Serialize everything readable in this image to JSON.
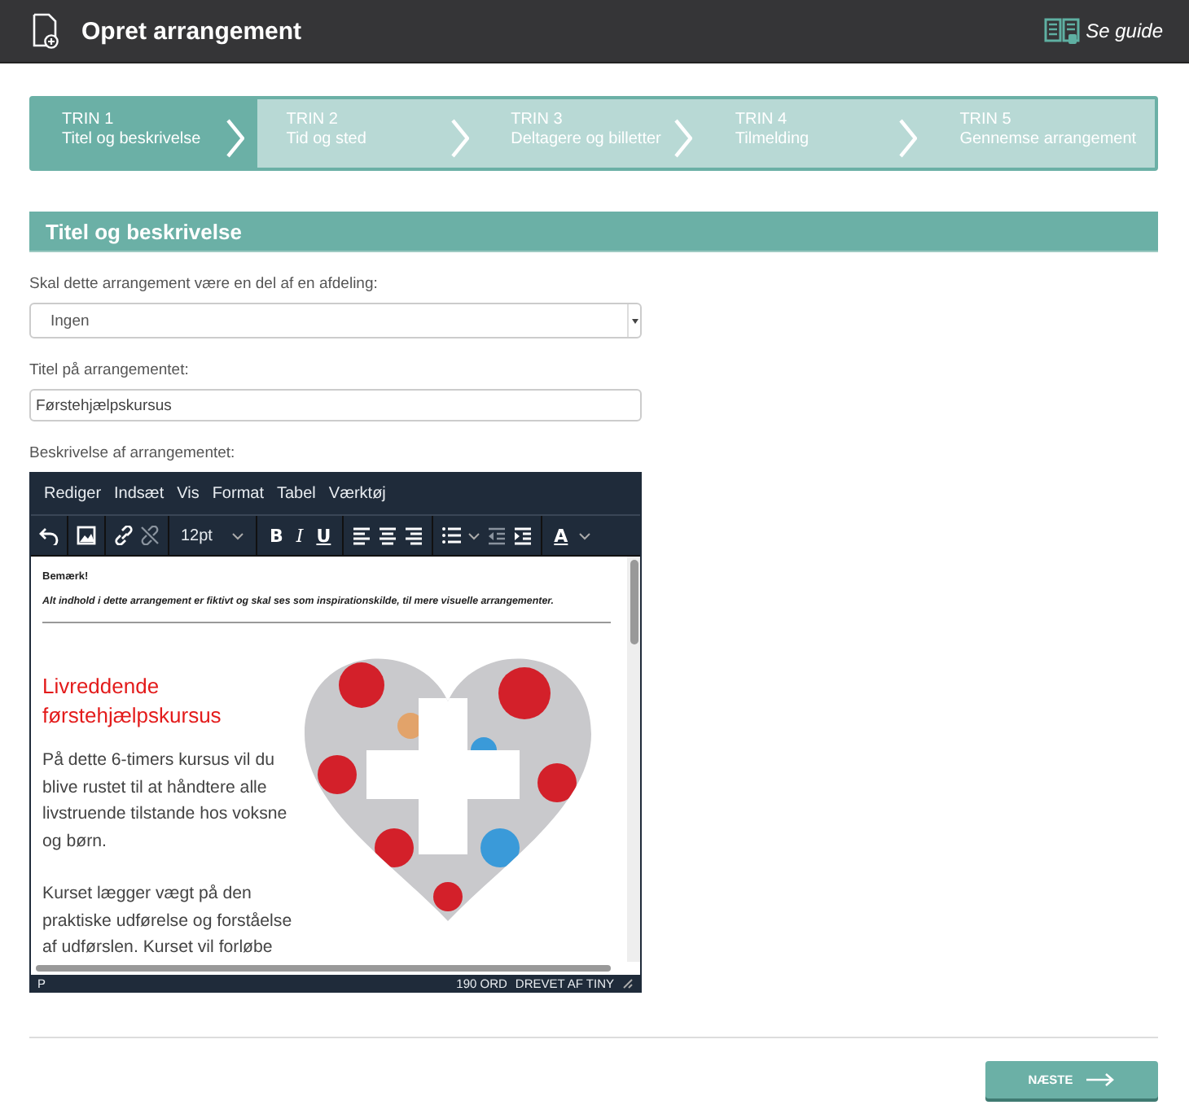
{
  "header": {
    "title": "Opret arrangement",
    "guide_link": "Se guide"
  },
  "steps": [
    {
      "step": "TRIN 1",
      "label": "Titel og beskrivelse",
      "selected": true
    },
    {
      "step": "TRIN 2",
      "label": "Tid og sted",
      "selected": false
    },
    {
      "step": "TRIN 3",
      "label": "Deltagere og billetter",
      "selected": false
    },
    {
      "step": "TRIN 4",
      "label": "Tilmelding",
      "selected": false
    },
    {
      "step": "TRIN 5",
      "label": "Gennemse arrangement",
      "selected": false
    }
  ],
  "section": {
    "title": "Titel og beskrivelse"
  },
  "department": {
    "label": "Skal dette arrangement være en del af en afdeling:",
    "value": "Ingen"
  },
  "title_field": {
    "label": "Titel på arrangementet:",
    "value": "Førstehjælpskursus"
  },
  "editor": {
    "label": "Beskrivelse af arrangementet:",
    "menu": [
      "Rediger",
      "Indsæt",
      "Vis",
      "Format",
      "Tabel",
      "Værktøj"
    ],
    "font_size": "12pt",
    "format_buttons": [
      "B",
      "I",
      "U"
    ],
    "color_button": "A",
    "note_title": "Bemærk!",
    "note_text": "Alt indhold i dette arrangement er fiktivt og skal ses som inspirationskilde, til mere visuelle arrangementer.",
    "heading": "Livreddende førstehjælpskursus",
    "paragraphs": [
      "På dette 6-timers kursus vil du blive rustet til at håndtere alle livstruende tilstande hos voksne og børn.",
      "Kurset lægger vægt på den praktiske udførelse og forståelse af udførslen. Kurset vil forløbe"
    ],
    "image": {
      "kind": "picture"
    },
    "status_path": "P",
    "word_count": "190 ORD",
    "powered_by": "DREVET AF TINY"
  },
  "next_button": "NÆSTE"
}
